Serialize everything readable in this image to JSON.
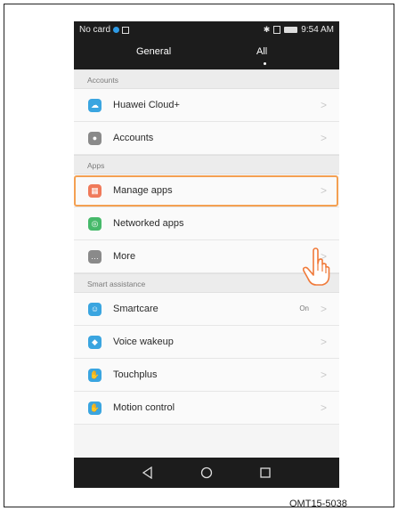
{
  "statusbar": {
    "carrier": "No card",
    "time": "9:54 AM",
    "icons": [
      "blue-dot-icon",
      "image-icon",
      "bluetooth-icon",
      "sim-icon",
      "battery-icon"
    ]
  },
  "tabs": {
    "general": "General",
    "all": "All",
    "selected": "All"
  },
  "sections": {
    "accounts": "Accounts",
    "apps": "Apps",
    "smart": "Smart assistance"
  },
  "rows": [
    {
      "label": "Huawei Cloud+",
      "icon": "cloud-icon",
      "color": "#3aa5e0"
    },
    {
      "label": "Accounts",
      "icon": "account-icon",
      "color": "#8a8a8a"
    },
    {
      "label": "Manage apps",
      "icon": "apps-grid-icon",
      "color": "#f07a5a"
    },
    {
      "label": "Networked apps",
      "icon": "network-icon",
      "color": "#46b96a"
    },
    {
      "label": "More",
      "icon": "more-icon",
      "color": "#8a8a8a"
    },
    {
      "label": "Smartcare",
      "icon": "smartcare-icon",
      "color": "#3aa5e0",
      "status": "On"
    },
    {
      "label": "Voice wakeup",
      "icon": "voice-icon",
      "color": "#3aa5e0"
    },
    {
      "label": "Touchplus",
      "icon": "touch-icon",
      "color": "#3aa5e0"
    },
    {
      "label": "Motion control",
      "icon": "motion-icon",
      "color": "#3aa5e0"
    }
  ],
  "highlight_color": "#f4a052",
  "caption": "OMT15-5038"
}
